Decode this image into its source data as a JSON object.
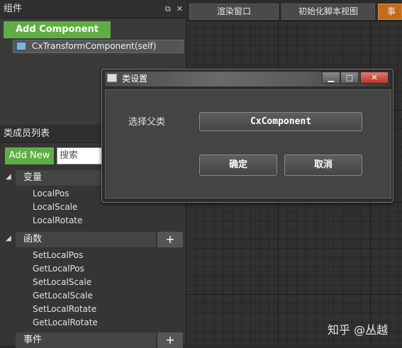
{
  "components_panel": {
    "title": "组件",
    "float_icon": "restore-icon",
    "close_glyph": "✕",
    "add_button": "Add Component",
    "items": [
      {
        "label": "CxTransformComponent(self)",
        "icon": "component-icon"
      }
    ]
  },
  "members_panel": {
    "title": "类成员列表",
    "add_button": "Add New",
    "search_placeholder": "搜索",
    "sections": [
      {
        "label": "变量",
        "items": [
          "LocalPos",
          "LocalScale",
          "LocalRotate"
        ]
      },
      {
        "label": "函数",
        "has_add": true,
        "items": [
          "SetLocalPos",
          "GetLocalPos",
          "SetLocalScale",
          "GetLocalScale",
          "SetLocalRotate",
          "GetLocalRotate"
        ]
      },
      {
        "label": "事件",
        "has_add": true,
        "items": []
      }
    ],
    "plus_glyph": "+",
    "caret_glyph": "◢"
  },
  "tabs": [
    {
      "label": "渲染窗口",
      "active": false
    },
    {
      "label": "初始化脚本视图",
      "active": false
    },
    {
      "label": "事",
      "active": true,
      "color": "#c56a1a"
    }
  ],
  "dialog": {
    "title": "类设置",
    "minimize_glyph": "▁",
    "maximize_glyph": "□",
    "close_glyph": "✕",
    "parent_label": "选择父类",
    "parent_value": "CxComponent",
    "ok_label": "确定",
    "cancel_label": "取消"
  },
  "watermark": "知乎 @丛越",
  "colors": {
    "accent_green": "#5fae45",
    "active_tab": "#c56a1a"
  }
}
